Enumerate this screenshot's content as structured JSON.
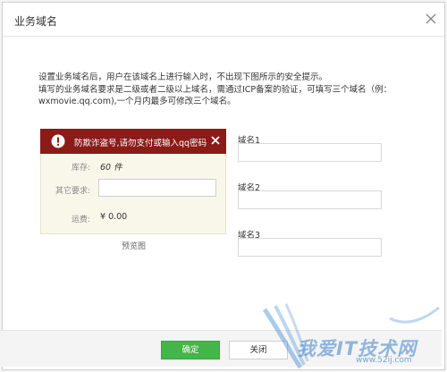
{
  "dialog": {
    "title": "业务域名"
  },
  "description": {
    "line1": "设置业务域名后，用户在该域名上进行输入时，不出现下图所示的安全提示。",
    "line2": "填写的业务域名要求是二级或者二级以上域名，需通过ICP备案的验证，可填写三个域名（例：",
    "line3": "wxmovie.qq.com),一个月内最多可修改三个域名。"
  },
  "preview": {
    "warning_text": "防欺诈盗号,请勿支付或输入qq密码",
    "stock_label": "库存:",
    "stock_value": "60 件",
    "other_label": "其它要求:",
    "shipping_label": "运费:",
    "shipping_value": "¥ 0.00",
    "caption": "预览图"
  },
  "domains": [
    {
      "label": "域名1",
      "value": ""
    },
    {
      "label": "域名2",
      "value": ""
    },
    {
      "label": "域名3",
      "value": ""
    }
  ],
  "footer": {
    "ok_label": "确定",
    "cancel_label": "关闭"
  },
  "watermark": {
    "text": "我爱IT技术网",
    "url": "www.52ij.com"
  },
  "colors": {
    "warning_bar": "#8b1b18",
    "ok_button": "#44b549",
    "preview_bg": "#f9f7ea"
  }
}
